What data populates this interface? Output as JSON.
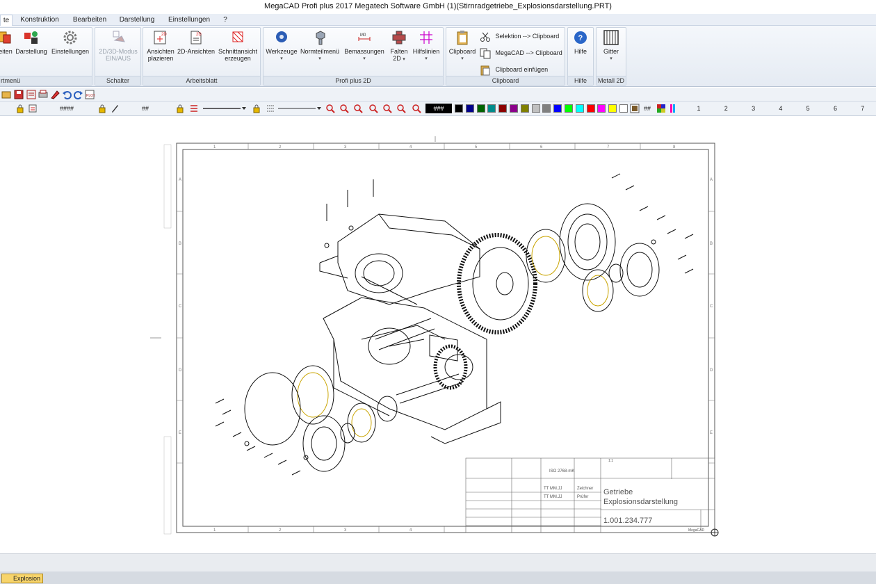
{
  "window": {
    "title": "MegaCAD Profi plus 2017  Megatech Software GmbH (1)(Stirnradgetriebe_Explosionsdarstellung.PRT)"
  },
  "menu": {
    "tabs": [
      {
        "label": "te",
        "active": true
      },
      {
        "label": "Konstruktion"
      },
      {
        "label": "Bearbeiten"
      },
      {
        "label": "Darstellung"
      },
      {
        "label": "Einstellungen"
      },
      {
        "label": "?"
      }
    ]
  },
  "ribbon": {
    "groups": [
      {
        "label": "rtmenü",
        "buttons": [
          {
            "label": "eiten",
            "icon": "layers-icon"
          },
          {
            "label": "Darstellung",
            "icon": "display-icon"
          },
          {
            "label": "Einstellungen",
            "icon": "gear-icon"
          }
        ]
      },
      {
        "label": "Schalter",
        "buttons": [
          {
            "label": "2D/3D-Modus",
            "label2": "EIN/AUS",
            "icon": "mode-toggle-icon",
            "disabled": true
          }
        ]
      },
      {
        "label": "Arbeitsblatt",
        "buttons": [
          {
            "label": "Ansichten",
            "label2": "plazieren",
            "icon": "place-views-icon"
          },
          {
            "label": "2D-Ansichten",
            "icon": "2d-views-icon"
          },
          {
            "label": "Schnittansicht",
            "label2": "erzeugen",
            "icon": "section-view-icon"
          }
        ]
      },
      {
        "label": "Profi plus 2D",
        "buttons": [
          {
            "label": "Werkzeuge",
            "icon": "tools-icon"
          },
          {
            "label": "Normteilmenü",
            "icon": "standard-parts-icon"
          },
          {
            "label": "Bemassungen",
            "icon": "dimension-icon"
          },
          {
            "label": "Falten",
            "label2": "2D",
            "icon": "fold-icon"
          },
          {
            "label": "Hilfslinien",
            "icon": "guidelines-icon"
          }
        ]
      },
      {
        "label": "Clipboard",
        "buttons": [
          {
            "label": "Clipboard",
            "icon": "clipboard-icon"
          }
        ],
        "small": [
          {
            "label": "Selektion --> Clipboard",
            "icon": "scissors-icon"
          },
          {
            "label": "MegaCAD --> Clipboard",
            "icon": "copy-icon"
          },
          {
            "label": "Clipboard einfügen",
            "icon": "paste-icon"
          }
        ]
      },
      {
        "label": "Hilfe",
        "buttons": [
          {
            "label": "Hilfe",
            "icon": "help-icon"
          }
        ]
      },
      {
        "label": "Metall 2D",
        "buttons": [
          {
            "label": "Gitter",
            "icon": "grid-icon"
          }
        ]
      }
    ]
  },
  "toolbar2": {
    "field1": "####",
    "field2": "##",
    "field3": "###",
    "field4": "##",
    "numbers": [
      "1",
      "2",
      "3",
      "4",
      "5",
      "6",
      "7"
    ],
    "palette": [
      "#000000",
      "#00008b",
      "#006400",
      "#008b8b",
      "#8b0000",
      "#8b008b",
      "#808000",
      "#c0c0c0",
      "#808080",
      "#0000ff",
      "#00ff00",
      "#00ffff",
      "#ff0000",
      "#ff00ff",
      "#ffff00",
      "#ffffff"
    ]
  },
  "drawing": {
    "grid_columns": [
      "1",
      "2",
      "3",
      "4",
      "5",
      "6",
      "7",
      "8"
    ],
    "grid_rows": [
      "A",
      "B",
      "C",
      "D",
      "E"
    ],
    "title_block": {
      "standard": "ISO 2768-mK",
      "scale": "1:1",
      "drawn_by": "TT MM.JJ",
      "role1": "Zeichner",
      "checked_by": "TT MM.JJ",
      "role2": "Prüfer",
      "title1": "Getriebe",
      "title2": "Explosionsdarstellung",
      "number": "1.001.234.777",
      "footer": "MegaCAD"
    }
  },
  "status": {
    "tab": "Explosion"
  },
  "colors": {
    "ribbon_bg": "#e5ebf3",
    "accent": "#3a6fc4",
    "status_tab": "#f7d46b"
  }
}
